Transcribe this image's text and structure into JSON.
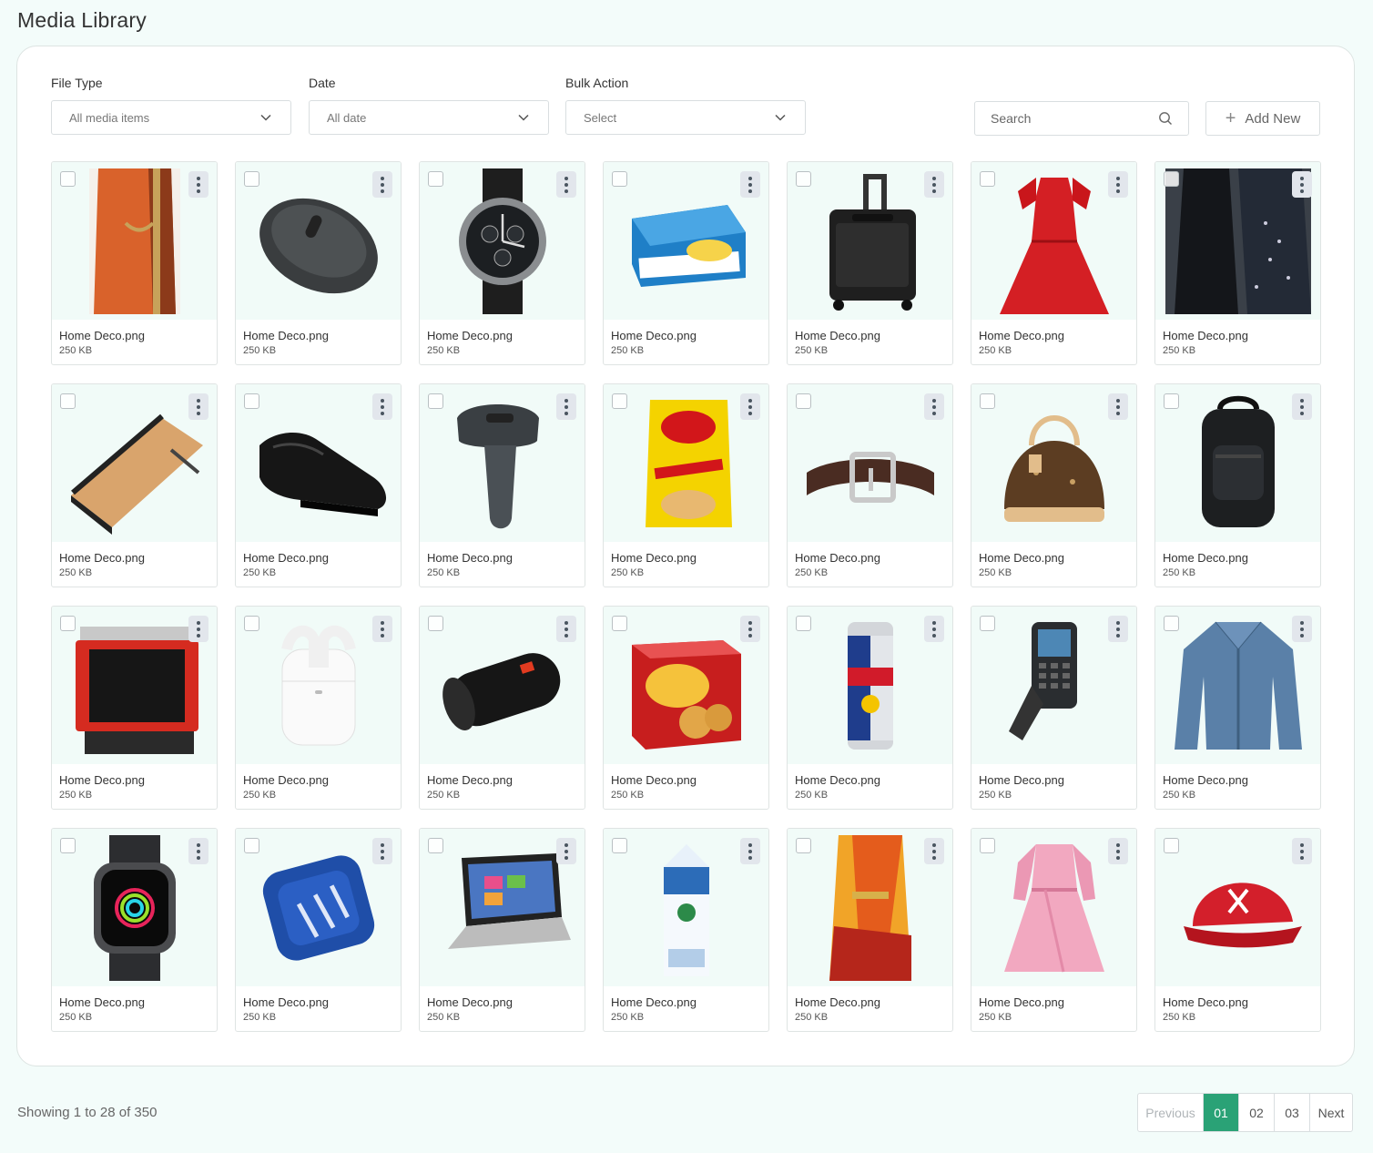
{
  "page": {
    "title": "Media Library"
  },
  "filters": {
    "file_type": {
      "label": "File Type",
      "value": "All media items"
    },
    "date": {
      "label": "Date",
      "value": "All date"
    },
    "bulk_action": {
      "label": "Bulk Action",
      "value": "Select"
    }
  },
  "search": {
    "placeholder": "Search"
  },
  "add_button": {
    "label": "Add New"
  },
  "items": [
    {
      "name": "Home Deco.png",
      "size": "250 KB",
      "icon": "saree-icon"
    },
    {
      "name": "Home Deco.png",
      "size": "250 KB",
      "icon": "mouse-icon"
    },
    {
      "name": "Home Deco.png",
      "size": "250 KB",
      "icon": "watch-icon"
    },
    {
      "name": "Home Deco.png",
      "size": "250 KB",
      "icon": "butter-icon"
    },
    {
      "name": "Home Deco.png",
      "size": "250 KB",
      "icon": "luggage-icon"
    },
    {
      "name": "Home Deco.png",
      "size": "250 KB",
      "icon": "dress-icon"
    },
    {
      "name": "Home Deco.png",
      "size": "250 KB",
      "icon": "abaya-icon"
    },
    {
      "name": "Home Deco.png",
      "size": "250 KB",
      "icon": "notebook-icon"
    },
    {
      "name": "Home Deco.png",
      "size": "250 KB",
      "icon": "shoe-icon"
    },
    {
      "name": "Home Deco.png",
      "size": "250 KB",
      "icon": "scanner-icon"
    },
    {
      "name": "Home Deco.png",
      "size": "250 KB",
      "icon": "chips-icon"
    },
    {
      "name": "Home Deco.png",
      "size": "250 KB",
      "icon": "belt-icon"
    },
    {
      "name": "Home Deco.png",
      "size": "250 KB",
      "icon": "handbag-icon"
    },
    {
      "name": "Home Deco.png",
      "size": "250 KB",
      "icon": "backpack-icon"
    },
    {
      "name": "Home Deco.png",
      "size": "250 KB",
      "icon": "stamp-icon"
    },
    {
      "name": "Home Deco.png",
      "size": "250 KB",
      "icon": "earbuds-icon"
    },
    {
      "name": "Home Deco.png",
      "size": "250 KB",
      "icon": "speaker-icon"
    },
    {
      "name": "Home Deco.png",
      "size": "250 KB",
      "icon": "crackers-icon"
    },
    {
      "name": "Home Deco.png",
      "size": "250 KB",
      "icon": "can-icon"
    },
    {
      "name": "Home Deco.png",
      "size": "250 KB",
      "icon": "handheld-scanner-icon"
    },
    {
      "name": "Home Deco.png",
      "size": "250 KB",
      "icon": "jacket-icon"
    },
    {
      "name": "Home Deco.png",
      "size": "250 KB",
      "icon": "smartwatch-icon"
    },
    {
      "name": "Home Deco.png",
      "size": "250 KB",
      "icon": "bluetooth-speaker-icon"
    },
    {
      "name": "Home Deco.png",
      "size": "250 KB",
      "icon": "laptop-icon"
    },
    {
      "name": "Home Deco.png",
      "size": "250 KB",
      "icon": "milk-carton-icon"
    },
    {
      "name": "Home Deco.png",
      "size": "250 KB",
      "icon": "yellow-saree-icon"
    },
    {
      "name": "Home Deco.png",
      "size": "250 KB",
      "icon": "pink-dress-icon"
    },
    {
      "name": "Home Deco.png",
      "size": "250 KB",
      "icon": "cap-icon"
    }
  ],
  "footer": {
    "showing": "Showing 1 to 28 of 350",
    "pagination": {
      "previous": "Previous",
      "pages": [
        "01",
        "02",
        "03"
      ],
      "current": "01",
      "next": "Next"
    }
  },
  "colors": {
    "accent": "#2aa276",
    "background": "#f3fcfa",
    "thumb_bg": "#f1fbf8"
  }
}
